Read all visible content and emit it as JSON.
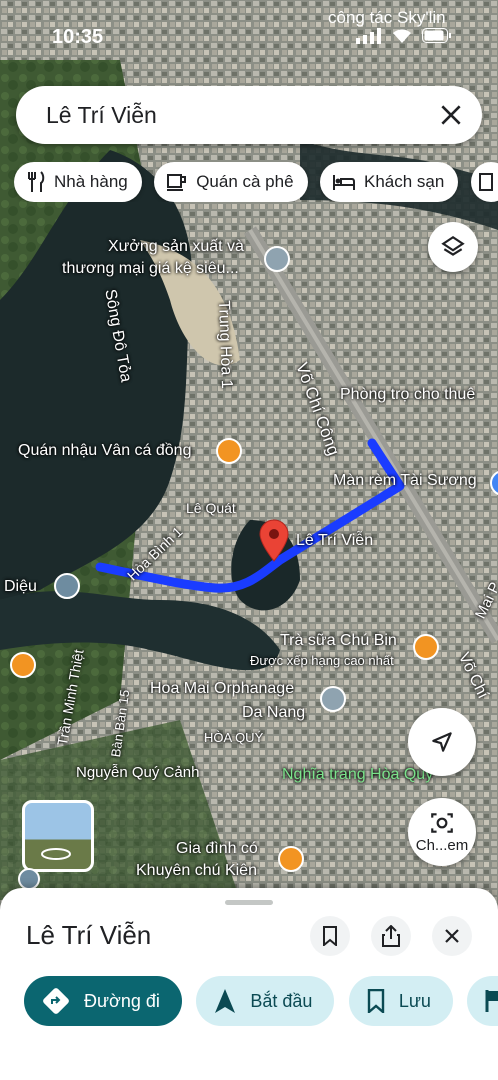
{
  "status": {
    "time": "10:35",
    "carrier": "công tác Sky'lin"
  },
  "search": {
    "query": "Lê Trí Viễn"
  },
  "chips": [
    {
      "label": "Nhà hàng",
      "icon": "fork-knife-icon"
    },
    {
      "label": "Quán cà phê",
      "icon": "coffee-icon"
    },
    {
      "label": "Khách sạn",
      "icon": "bed-icon"
    }
  ],
  "map_labels": {
    "factory": "Xưởng sản xuất và thương mại giá kệ siêu...",
    "factory_l1": "Xưởng sản xuất và",
    "factory_l2": "thương mại giá kệ siêu...",
    "river": "Sông Đô Tỏa",
    "trung_hoa": "Trung Hòa 1",
    "vo_chi_cong": "Võ Chí Công",
    "phong_tro": "Phòng trọ cho thuê",
    "quan_nhau": "Quán nhậu Vân cá đồng",
    "man_rem": "Màn rèm Tài Sương",
    "le_quat": "Lê Quát",
    "hoa_binh": "Hòa Bình 1",
    "destination": "Lê Trí Viễn",
    "dieu": "Diệu",
    "tra_sua": "Trà sữa Chú Bin",
    "tra_sua_sub": "Được xếp hạng cao nhất",
    "tran_minh_thiet": "Trần Minh Thiệt",
    "orphanage_l1": "Hoa Mai Orphanage",
    "orphanage_l2": "Da Nang",
    "ban_ban": "Bàn Bàn 15",
    "hoa_quy": "HÒA QUÝ",
    "nguyen_quy_canh": "Nguyễn Quý Cảnh",
    "nghia_trang": "Nghĩa trang Hòa Quý",
    "gia_dinh_l1": "Gia đình có",
    "gia_dinh_l2": "Khuyên chú Kiên",
    "vo_chi_right": "Võ Chí",
    "mai_right": "Mai P"
  },
  "camera_button": {
    "label": "Ch...em"
  },
  "sheet": {
    "title": "Lê Trí Viễn",
    "actions": [
      {
        "label": "Đường đi",
        "icon": "directions-icon"
      },
      {
        "label": "Bắt đầu",
        "icon": "navigation-arrow-icon"
      },
      {
        "label": "Lưu",
        "icon": "bookmark-icon"
      },
      {
        "label": "",
        "icon": "flag-icon"
      }
    ]
  },
  "colors": {
    "route": "#1a3cff",
    "pin": "#ea4335",
    "primary": "#0b6670",
    "secondary": "#d3eef3"
  }
}
